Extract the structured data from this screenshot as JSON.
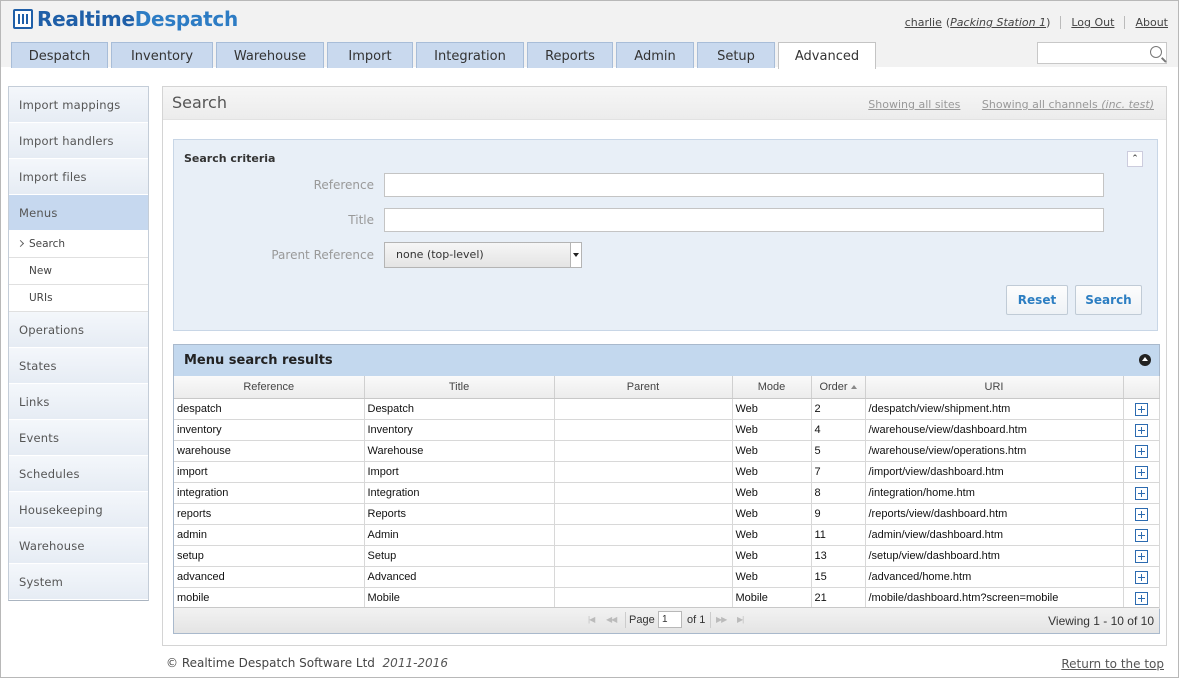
{
  "app": {
    "logo_part1": "Realtime",
    "logo_part2": "Despatch"
  },
  "user": {
    "name": "charlie",
    "station": "Packing Station 1",
    "logout": "Log Out",
    "about": "About"
  },
  "tabs": [
    "Despatch",
    "Inventory",
    "Warehouse",
    "Import",
    "Integration",
    "Reports",
    "Admin",
    "Setup",
    "Advanced"
  ],
  "active_tab": "Advanced",
  "sidebar": {
    "items": [
      "Import mappings",
      "Import handlers",
      "Import files",
      "Menus"
    ],
    "subitems": [
      "Search",
      "New",
      "URIs"
    ],
    "items_after": [
      "Operations",
      "States",
      "Links",
      "Events",
      "Schedules",
      "Housekeeping",
      "Warehouse",
      "System"
    ]
  },
  "page": {
    "title": "Search",
    "showing_sites": "Showing all sites",
    "showing_channels": "Showing all channels",
    "channels_suffix": "(inc. test)"
  },
  "criteria": {
    "title": "Search criteria",
    "reference_label": "Reference",
    "title_label": "Title",
    "parent_label": "Parent Reference",
    "parent_value": "none (top-level)",
    "reset": "Reset",
    "search": "Search"
  },
  "results": {
    "title": "Menu search results",
    "columns": [
      "Reference",
      "Title",
      "Parent",
      "Mode",
      "Order",
      "URI",
      ""
    ],
    "rows": [
      [
        "despatch",
        "Despatch",
        "",
        "Web",
        "2",
        "/despatch/view/shipment.htm"
      ],
      [
        "inventory",
        "Inventory",
        "",
        "Web",
        "4",
        "/warehouse/view/dashboard.htm"
      ],
      [
        "warehouse",
        "Warehouse",
        "",
        "Web",
        "5",
        "/warehouse/view/operations.htm"
      ],
      [
        "import",
        "Import",
        "",
        "Web",
        "7",
        "/import/view/dashboard.htm"
      ],
      [
        "integration",
        "Integration",
        "",
        "Web",
        "8",
        "/integration/home.htm"
      ],
      [
        "reports",
        "Reports",
        "",
        "Web",
        "9",
        "/reports/view/dashboard.htm"
      ],
      [
        "admin",
        "Admin",
        "",
        "Web",
        "11",
        "/admin/view/dashboard.htm"
      ],
      [
        "setup",
        "Setup",
        "",
        "Web",
        "13",
        "/setup/view/dashboard.htm"
      ],
      [
        "advanced",
        "Advanced",
        "",
        "Web",
        "15",
        "/advanced/home.htm"
      ],
      [
        "mobile",
        "Mobile",
        "",
        "Mobile",
        "21",
        "/mobile/dashboard.htm?screen=mobile"
      ]
    ],
    "pager": {
      "page_label": "Page",
      "page_value": "1",
      "of_label": "of 1",
      "viewing": "Viewing 1 - 10 of 10"
    }
  },
  "footer": {
    "copyright": "© Realtime Despatch Software Ltd",
    "years": "2011-2016",
    "return_top": "Return to the top"
  }
}
